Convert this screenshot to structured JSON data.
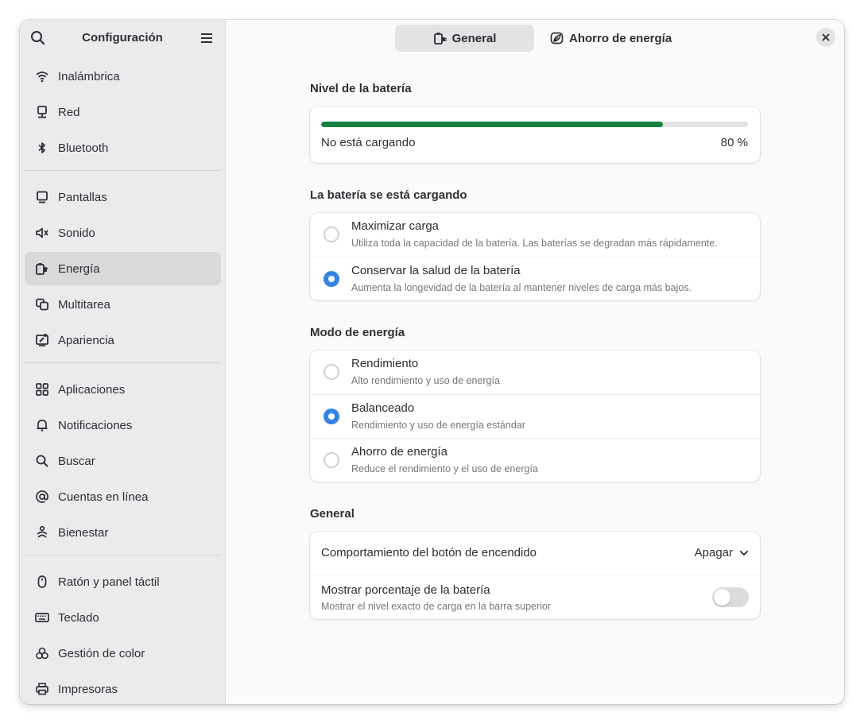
{
  "sidebar": {
    "title": "Configuración",
    "groups": [
      [
        {
          "label": "Inalámbrica",
          "icon": "wifi-icon"
        },
        {
          "label": "Red",
          "icon": "network-icon"
        },
        {
          "label": "Bluetooth",
          "icon": "bluetooth-icon"
        }
      ],
      [
        {
          "label": "Pantallas",
          "icon": "display-icon"
        },
        {
          "label": "Sonido",
          "icon": "speaker-icon"
        },
        {
          "label": "Energía",
          "icon": "power-plug-icon",
          "active": true
        },
        {
          "label": "Multitarea",
          "icon": "multitask-icon"
        },
        {
          "label": "Apariencia",
          "icon": "appearance-icon"
        }
      ],
      [
        {
          "label": "Aplicaciones",
          "icon": "apps-grid-icon"
        },
        {
          "label": "Notificaciones",
          "icon": "bell-icon"
        },
        {
          "label": "Buscar",
          "icon": "search-icon"
        },
        {
          "label": "Cuentas en línea",
          "icon": "at-sign-icon"
        },
        {
          "label": "Bienestar",
          "icon": "wellbeing-icon"
        }
      ],
      [
        {
          "label": "Ratón y panel táctil",
          "icon": "mouse-icon"
        },
        {
          "label": "Teclado",
          "icon": "keyboard-icon"
        },
        {
          "label": "Gestión de color",
          "icon": "color-management-icon"
        },
        {
          "label": "Impresoras",
          "icon": "printer-icon"
        }
      ]
    ]
  },
  "tabs": [
    {
      "label": "General",
      "icon": "power-plug-icon",
      "active": true
    },
    {
      "label": "Ahorro de energía",
      "icon": "leaf-icon",
      "active": false
    }
  ],
  "battery": {
    "section_title": "Nivel de la batería",
    "status": "No está cargando",
    "percent_label": "80 %",
    "level": 0.8,
    "fill_color": "#188142"
  },
  "charging": {
    "section_title": "La batería se está cargando",
    "options": [
      {
        "title": "Maximizar carga",
        "subtitle": "Utiliza toda la capacidad de la batería. Las baterías se degradan más rápidamente.",
        "checked": false
      },
      {
        "title": "Conservar la salud de la batería",
        "subtitle": "Aumenta la longevidad de la batería al mantener niveles de carga más bajos.",
        "checked": true
      }
    ]
  },
  "power_mode": {
    "section_title": "Modo de energía",
    "options": [
      {
        "title": "Rendimiento",
        "subtitle": "Alto rendimiento y uso de energía",
        "checked": false
      },
      {
        "title": "Balanceado",
        "subtitle": "Rendimiento y uso de energía estándar",
        "checked": true
      },
      {
        "title": "Ahorro de energía",
        "subtitle": "Reduce el rendimiento y el uso de energía",
        "checked": false
      }
    ]
  },
  "general": {
    "section_title": "General",
    "power_button_label": "Comportamiento del botón de encendido",
    "power_button_value": "Apagar",
    "show_percentage_label": "Mostrar porcentaje de la batería",
    "show_percentage_subtitle": "Mostrar el nivel exacto de carga en la barra superior",
    "show_percentage_on": false
  },
  "colors": {
    "accent": "#3584e4",
    "sidebar_bg": "#ebebed",
    "content_bg": "#fafafb"
  }
}
